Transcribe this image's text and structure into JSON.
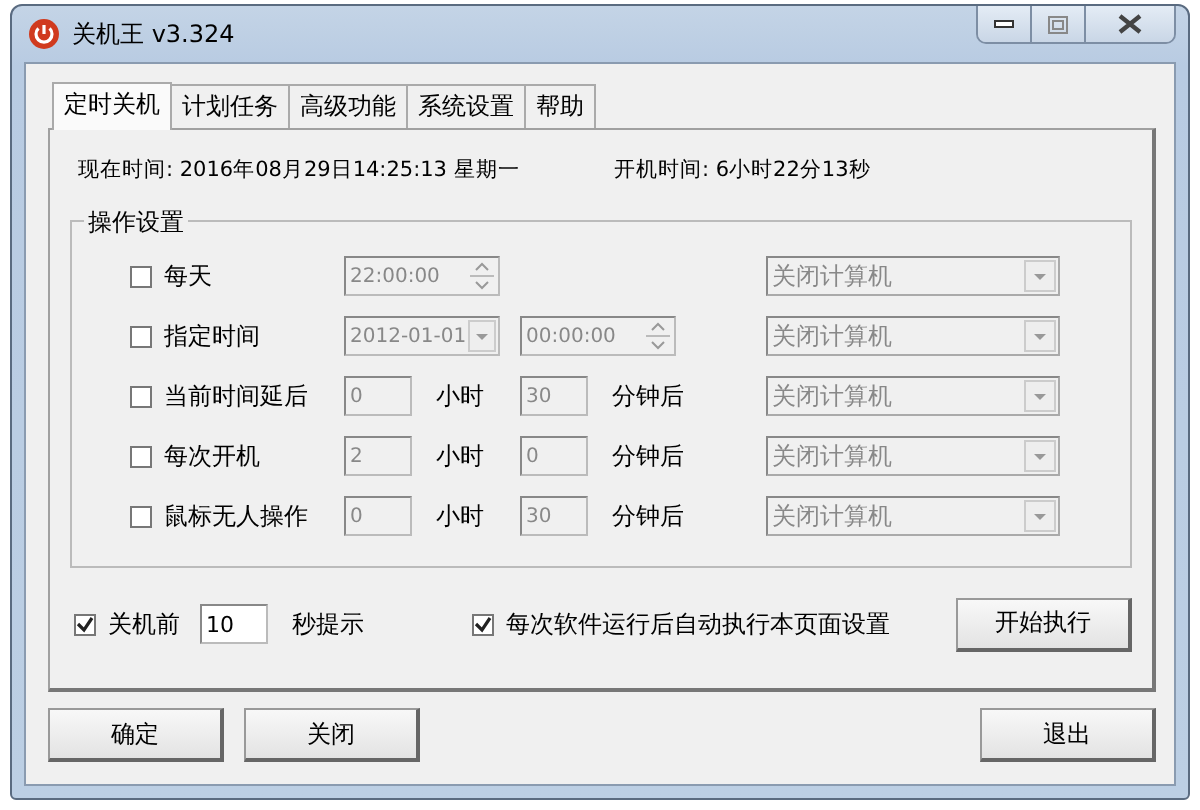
{
  "window": {
    "title": "关机王 v3.324"
  },
  "tabs": [
    {
      "label": "定时关机",
      "selected": true
    },
    {
      "label": "计划任务",
      "selected": false
    },
    {
      "label": "高级功能",
      "selected": false
    },
    {
      "label": "系统设置",
      "selected": false
    },
    {
      "label": "帮助",
      "selected": false
    }
  ],
  "info": {
    "current_time_label": "现在时间:",
    "current_time": "2016年08月29日14:25:13 星期一",
    "uptime_label": "开机时间:",
    "uptime": "6小时22分13秒"
  },
  "group": {
    "title": "操作设置",
    "rows": [
      {
        "kind": "time",
        "label": "每天",
        "checked": false,
        "time": "22:00:00",
        "action": "关闭计算机"
      },
      {
        "kind": "datetime",
        "label": "指定时间",
        "checked": false,
        "date": "2012-01-01",
        "time": "00:00:00",
        "action": "关闭计算机"
      },
      {
        "kind": "duration",
        "label": "当前时间延后",
        "checked": false,
        "hours": "0",
        "hours_unit": "小时",
        "minutes": "30",
        "minutes_unit": "分钟后",
        "action": "关闭计算机"
      },
      {
        "kind": "duration",
        "label": "每次开机",
        "checked": false,
        "hours": "2",
        "hours_unit": "小时",
        "minutes": "0",
        "minutes_unit": "分钟后",
        "action": "关闭计算机"
      },
      {
        "kind": "duration",
        "label": "鼠标无人操作",
        "checked": false,
        "hours": "0",
        "hours_unit": "小时",
        "minutes": "30",
        "minutes_unit": "分钟后",
        "action": "关闭计算机"
      }
    ]
  },
  "warn": {
    "checked": true,
    "label": "关机前",
    "seconds": "10",
    "suffix": "秒提示"
  },
  "auto_run": {
    "checked": true,
    "label": "每次软件运行后自动执行本页面设置"
  },
  "start_button": "开始执行",
  "buttons": [
    "确定",
    "关闭",
    "退出"
  ]
}
